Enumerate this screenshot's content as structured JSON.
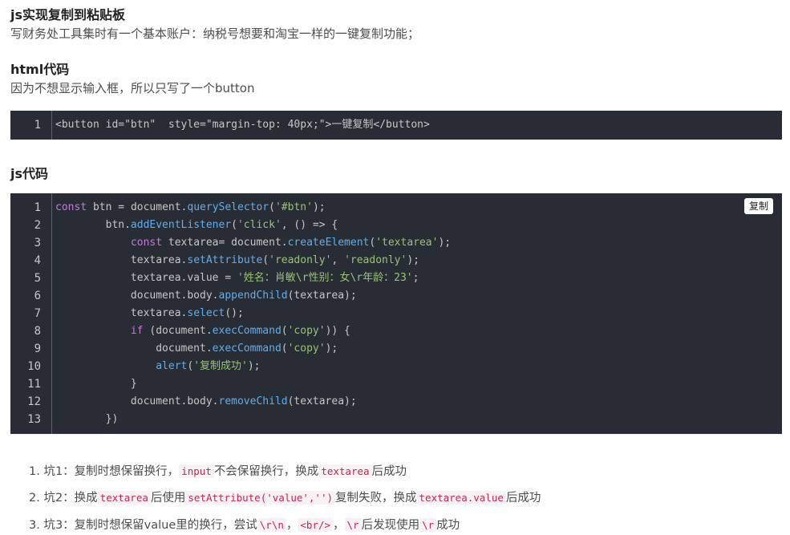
{
  "heading1": "js实现复制到粘贴板",
  "intro": "写财务处工具集时有一个基本账户：纳税号想要和淘宝一样的一键复制功能；",
  "heading_html": "html代码",
  "html_desc": "因为不想显示输入框，所以只写了一个button",
  "html_code": {
    "line_number": "1",
    "code": "<button id=\"btn\"  style=\"margin-top: 40px;\">一键复制</button>"
  },
  "heading_js": "js代码",
  "js_code": {
    "copy_label": "复制",
    "lines": [
      {
        "n": "1",
        "segs": [
          [
            "kw",
            "const"
          ],
          [
            "op",
            " btn = "
          ],
          [
            "op",
            "document."
          ],
          [
            "fn",
            "querySelector"
          ],
          [
            "op",
            "("
          ],
          [
            "str",
            "'#btn'"
          ],
          [
            "op",
            ");"
          ]
        ]
      },
      {
        "n": "2",
        "segs": [
          [
            "op",
            "        btn."
          ],
          [
            "fn",
            "addEventListener"
          ],
          [
            "op",
            "("
          ],
          [
            "str",
            "'click'"
          ],
          [
            "op",
            ", () => {"
          ]
        ]
      },
      {
        "n": "3",
        "segs": [
          [
            "op",
            "            "
          ],
          [
            "kw",
            "const"
          ],
          [
            "op",
            " textarea= document."
          ],
          [
            "fn",
            "createElement"
          ],
          [
            "op",
            "("
          ],
          [
            "str",
            "'textarea'"
          ],
          [
            "op",
            ");"
          ]
        ]
      },
      {
        "n": "4",
        "segs": [
          [
            "op",
            "            textarea."
          ],
          [
            "fn",
            "setAttribute"
          ],
          [
            "op",
            "("
          ],
          [
            "str",
            "'readonly'"
          ],
          [
            "op",
            ", "
          ],
          [
            "str",
            "'readonly'"
          ],
          [
            "op",
            ");"
          ]
        ]
      },
      {
        "n": "5",
        "segs": [
          [
            "op",
            "            textarea.value = "
          ],
          [
            "str",
            "'姓名：肖敏\\r性别：女\\r年龄：23'"
          ],
          [
            "op",
            ";"
          ]
        ]
      },
      {
        "n": "6",
        "segs": [
          [
            "op",
            "            document.body."
          ],
          [
            "fn",
            "appendChild"
          ],
          [
            "op",
            "(textarea);"
          ]
        ]
      },
      {
        "n": "7",
        "segs": [
          [
            "op",
            "            textarea."
          ],
          [
            "fn",
            "select"
          ],
          [
            "op",
            "();"
          ]
        ]
      },
      {
        "n": "8",
        "segs": [
          [
            "op",
            "            "
          ],
          [
            "kw",
            "if"
          ],
          [
            "op",
            " (document."
          ],
          [
            "fn",
            "execCommand"
          ],
          [
            "op",
            "("
          ],
          [
            "str",
            "'copy'"
          ],
          [
            "op",
            ")) {"
          ]
        ]
      },
      {
        "n": "9",
        "segs": [
          [
            "op",
            "                document."
          ],
          [
            "fn",
            "execCommand"
          ],
          [
            "op",
            "("
          ],
          [
            "str",
            "'copy'"
          ],
          [
            "op",
            ");"
          ]
        ]
      },
      {
        "n": "10",
        "segs": [
          [
            "op",
            "                "
          ],
          [
            "fn",
            "alert"
          ],
          [
            "op",
            "("
          ],
          [
            "str",
            "'复制成功'"
          ],
          [
            "op",
            ");"
          ]
        ]
      },
      {
        "n": "11",
        "segs": [
          [
            "op",
            "            }"
          ]
        ]
      },
      {
        "n": "12",
        "segs": [
          [
            "op",
            "            document.body."
          ],
          [
            "fn",
            "removeChild"
          ],
          [
            "op",
            "(textarea);"
          ]
        ]
      },
      {
        "n": "13",
        "segs": [
          [
            "op",
            "        })"
          ]
        ]
      }
    ]
  },
  "notes": [
    {
      "segs": [
        [
          "t",
          "1. 坑1：复制时想保留换行，"
        ],
        [
          "c",
          "input"
        ],
        [
          "t",
          "不会保留换行，换成"
        ],
        [
          "c",
          "textarea"
        ],
        [
          "t",
          "后成功"
        ]
      ]
    },
    {
      "segs": [
        [
          "t",
          "2. 坑2：换成"
        ],
        [
          "c",
          "textarea"
        ],
        [
          "t",
          "后使用"
        ],
        [
          "c",
          "setAttribute('value','')"
        ],
        [
          "t",
          "复制失败，换成"
        ],
        [
          "c",
          "textarea.value"
        ],
        [
          "t",
          "后成功"
        ]
      ]
    },
    {
      "segs": [
        [
          "t",
          "3. 坑3：复制时想保留value里的换行，尝试"
        ],
        [
          "c",
          "\\r\\n"
        ],
        [
          "t",
          "，"
        ],
        [
          "c",
          "<br/>"
        ],
        [
          "t",
          "，"
        ],
        [
          "c",
          "\\r"
        ],
        [
          "t",
          "后发现使用"
        ],
        [
          "c",
          "\\r"
        ],
        [
          "t",
          "成功"
        ]
      ]
    }
  ]
}
